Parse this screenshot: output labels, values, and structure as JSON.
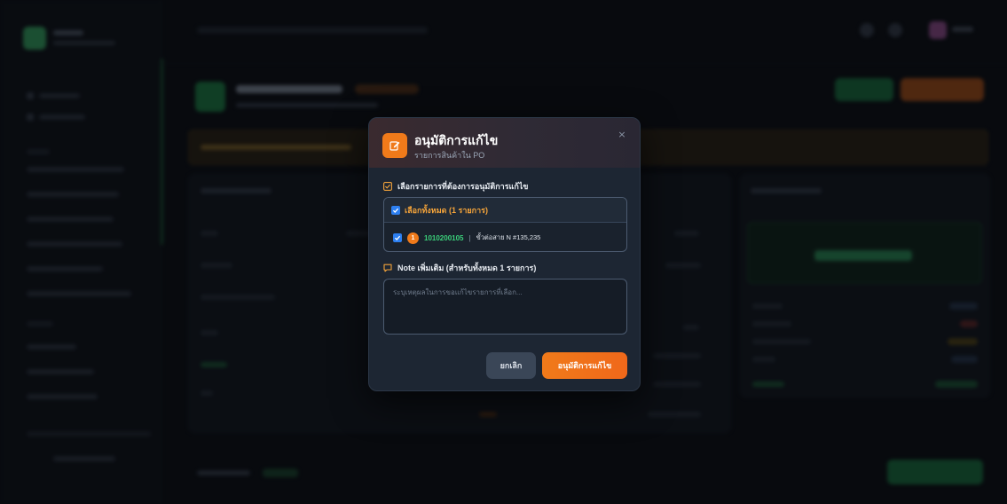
{
  "modal": {
    "title": "อนุมัติการแก้ไข",
    "subtitle": "รายการสินค้าใน PO",
    "close_icon": "×",
    "select_section_label": "เลือกรายการที่ต้องการอนุมัติการแก้ไข",
    "select_all_label": "เลือกทั้งหมด (1 รายการ)",
    "select_all_checked": true,
    "items": [
      {
        "index": "1",
        "code": "1010200105",
        "separator": "|",
        "description": "ขั้วต่อสาย N #135,235",
        "checked": true
      }
    ],
    "note_label": "Note เพิ่มเติม (สำหรับทั้งหมด 1 รายการ)",
    "note_placeholder": "ระบุเหตุผลในการขอแก้ไขรายการที่เลือก...",
    "cancel_label": "ยกเลิก",
    "approve_label": "อนุมัติการแก้ไข"
  },
  "colors": {
    "accent_orange": "#f07a1a",
    "checkbox_blue": "#2d7ff0",
    "code_green": "#3bd07a",
    "modal_bg": "#1d2633"
  },
  "icons": {
    "header": "edit-icon",
    "section": "checklist-icon",
    "note": "comment-icon",
    "close": "close-icon"
  }
}
